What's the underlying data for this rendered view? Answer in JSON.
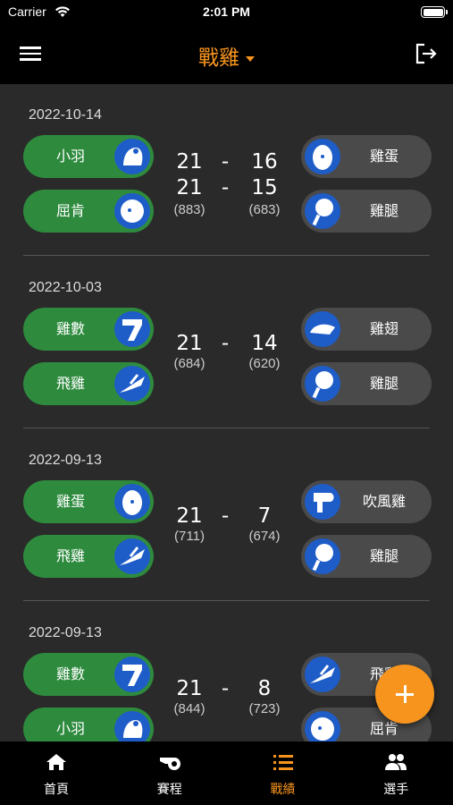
{
  "status_bar": {
    "carrier": "Carrier",
    "time": "2:01 PM"
  },
  "nav": {
    "title": "戰雞",
    "menu_icon": "hamburger-icon",
    "logout_icon": "logout-icon"
  },
  "accent_color": "#f7941d",
  "matches": [
    {
      "date": "2022-10-14",
      "team_left": [
        "小羽",
        "屈肯"
      ],
      "team_right": [
        "雞蛋",
        "雞腿"
      ],
      "games": [
        {
          "left": "21",
          "right": "16"
        },
        {
          "left": "21",
          "right": "15"
        }
      ],
      "points": {
        "left": "(883)",
        "right": "(683)"
      }
    },
    {
      "date": "2022-10-03",
      "team_left": [
        "雞數",
        "飛雞"
      ],
      "team_right": [
        "雞翅",
        "雞腿"
      ],
      "games": [
        {
          "left": "21",
          "right": "14"
        }
      ],
      "points": {
        "left": "(684)",
        "right": "(620)"
      }
    },
    {
      "date": "2022-09-13",
      "team_left": [
        "雞蛋",
        "飛雞"
      ],
      "team_right": [
        "吹風雞",
        "雞腿"
      ],
      "games": [
        {
          "left": "21",
          "right": "7"
        }
      ],
      "points": {
        "left": "(711)",
        "right": "(674)"
      }
    },
    {
      "date": "2022-09-13",
      "team_left": [
        "雞數",
        "小羽"
      ],
      "team_right": [
        "飛雞",
        "屈肯"
      ],
      "games": [
        {
          "left": "21",
          "right": "8"
        }
      ],
      "points": {
        "left": "(844)",
        "right": "(723)"
      }
    }
  ],
  "score_separator": "-",
  "fab": {
    "icon": "plus-icon"
  },
  "tabs": [
    {
      "label": "首頁",
      "icon": "home-icon",
      "active": false
    },
    {
      "label": "賽程",
      "icon": "whistle-icon",
      "active": false
    },
    {
      "label": "戰績",
      "icon": "list-icon",
      "active": true
    },
    {
      "label": "選手",
      "icon": "people-icon",
      "active": false
    }
  ]
}
